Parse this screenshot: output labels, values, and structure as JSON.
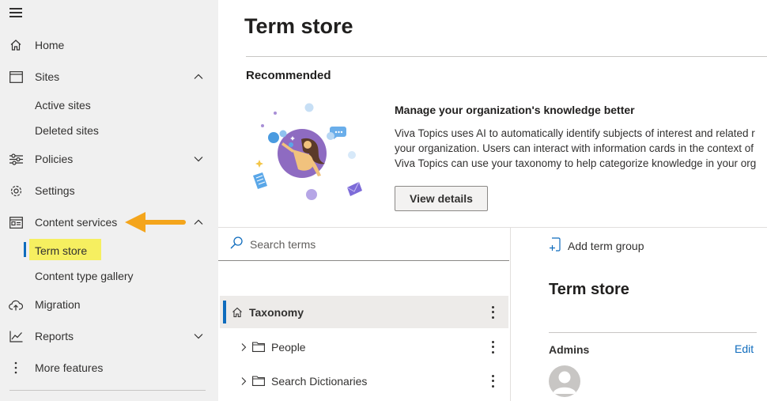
{
  "nav": {
    "items": [
      {
        "label": "Home",
        "icon": "home-icon"
      },
      {
        "label": "Sites",
        "icon": "sites-icon",
        "expanded": true
      },
      {
        "label": "Policies",
        "icon": "policies-icon",
        "expanded": false
      },
      {
        "label": "Settings",
        "icon": "settings-icon"
      },
      {
        "label": "Content services",
        "icon": "content-services-icon",
        "expanded": true
      },
      {
        "label": "Migration",
        "icon": "migration-icon"
      },
      {
        "label": "Reports",
        "icon": "reports-icon",
        "expanded": false
      },
      {
        "label": "More features",
        "icon": "more-features-icon"
      }
    ],
    "sites_sub": [
      "Active sites",
      "Deleted sites"
    ],
    "content_sub": [
      "Term store",
      "Content type gallery"
    ],
    "selected": "Term store"
  },
  "page": {
    "title": "Term store",
    "recommended_label": "Recommended",
    "promo": {
      "title": "Manage your organization's knowledge better",
      "lines": [
        "Viva Topics uses AI to automatically identify subjects of interest and related r",
        "your organization. Users can interact with information cards in the context of",
        "Viva Topics can use your taxonomy to help categorize knowledge in your org"
      ],
      "button": "View details"
    }
  },
  "tree": {
    "search_placeholder": "Search terms",
    "root": "Taxonomy",
    "groups": [
      "People",
      "Search Dictionaries"
    ]
  },
  "detail": {
    "add_group": "Add term group",
    "title": "Term store",
    "admins_label": "Admins",
    "edit_label": "Edit"
  },
  "colors": {
    "accent": "#0f6cbd",
    "highlight": "#f6ef60",
    "arrow": "#f4a51c",
    "illustration_purple": "#8e6bc1"
  }
}
